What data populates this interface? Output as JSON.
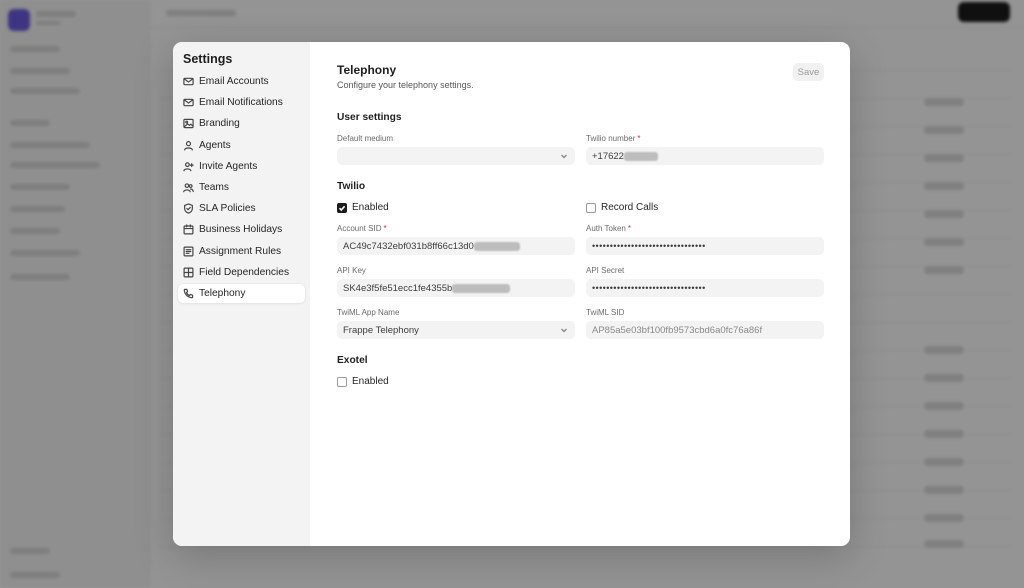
{
  "modal": {
    "sidebar_title": "Settings",
    "nav_items": [
      {
        "label": "Email Accounts",
        "icon": "mail-icon"
      },
      {
        "label": "Email Notifications",
        "icon": "mail-icon"
      },
      {
        "label": "Branding",
        "icon": "image-icon"
      },
      {
        "label": "Agents",
        "icon": "user-icon"
      },
      {
        "label": "Invite Agents",
        "icon": "user-plus-icon"
      },
      {
        "label": "Teams",
        "icon": "users-icon"
      },
      {
        "label": "SLA Policies",
        "icon": "shield-icon"
      },
      {
        "label": "Business Holidays",
        "icon": "calendar-icon"
      },
      {
        "label": "Assignment Rules",
        "icon": "list-icon"
      },
      {
        "label": "Field Dependencies",
        "icon": "grid-icon"
      },
      {
        "label": "Telephony",
        "icon": "phone-icon",
        "active": true
      }
    ],
    "title": "Telephony",
    "subtitle": "Configure your telephony settings.",
    "save_label": "Save",
    "user_settings": {
      "heading": "User settings",
      "default_medium_label": "Default medium",
      "default_medium_value": "",
      "twilio_number_label": "Twilio number",
      "twilio_number_value": "+17622"
    },
    "twilio": {
      "heading": "Twilio",
      "enabled_label": "Enabled",
      "enabled": true,
      "record_calls_label": "Record Calls",
      "record_calls": false,
      "account_sid_label": "Account SID",
      "account_sid_value": "AC49c7432ebf031b8ff66c13d0",
      "auth_token_label": "Auth Token",
      "auth_token_value": "••••••••••••••••••••••••••••••••",
      "api_key_label": "API Key",
      "api_key_value": "SK4e3f5fe51ecc1fe4355b",
      "api_secret_label": "API Secret",
      "api_secret_value": "••••••••••••••••••••••••••••••••",
      "twiml_app_label": "TwiML App Name",
      "twiml_app_value": "Frappe Telephony",
      "twiml_sid_label": "TwiML SID",
      "twiml_sid_value": "AP85a5e03bf100fb9573cbd6a0fc76a86f"
    },
    "exotel": {
      "heading": "Exotel",
      "enabled_label": "Enabled",
      "enabled": false
    },
    "required_mark": "*"
  }
}
